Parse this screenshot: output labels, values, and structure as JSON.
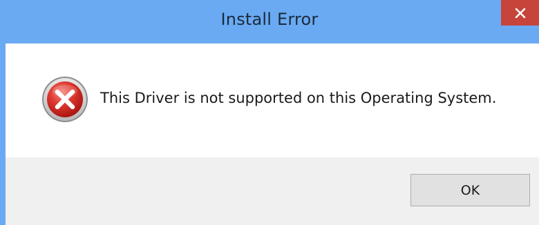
{
  "window": {
    "title": "Install Error"
  },
  "dialog": {
    "message": "This Driver is not supported on this Operating System.",
    "icon": "error-icon"
  },
  "buttons": {
    "ok_label": "OK",
    "close_glyph": "✕"
  },
  "colors": {
    "titlebar": "#6aaaf3",
    "close_button": "#c7443b",
    "error_red": "#d9302a",
    "button_area": "#f0f0f0"
  }
}
